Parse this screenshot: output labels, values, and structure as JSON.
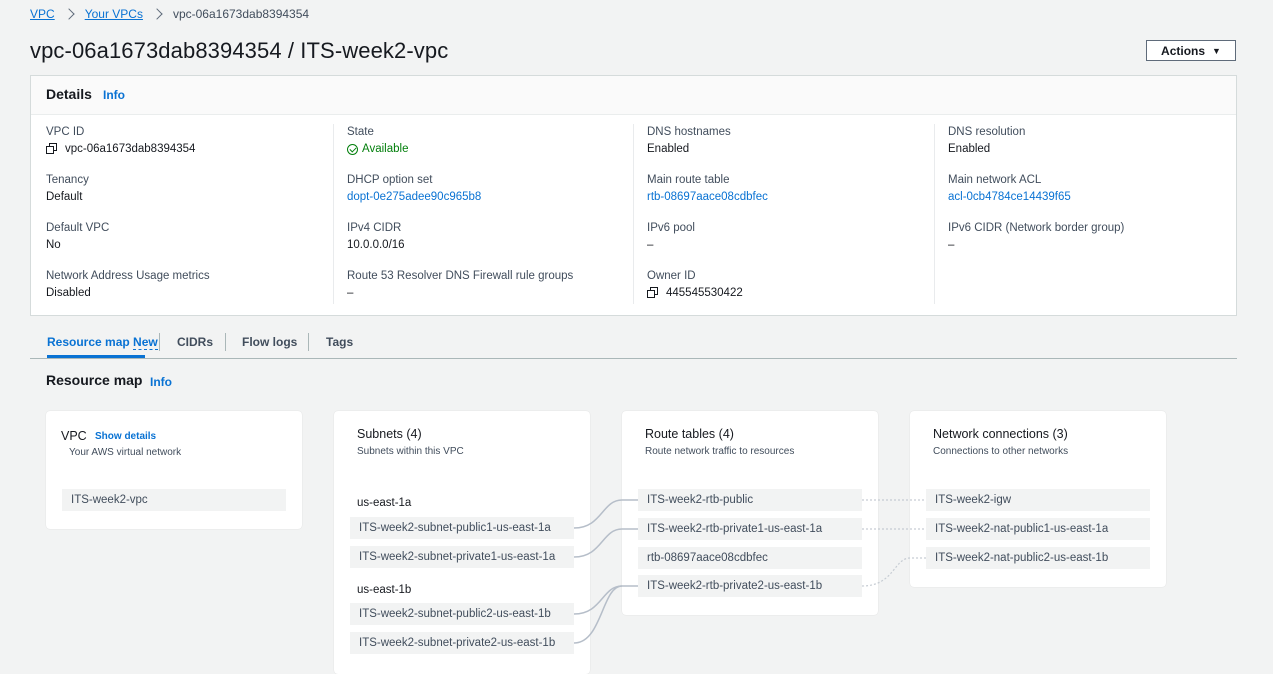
{
  "breadcrumb": {
    "vpc": "VPC",
    "your_vpcs": "Your VPCs",
    "current": "vpc-06a1673dab8394354"
  },
  "page_title": "vpc-06a1673dab8394354 / ITS-week2-vpc",
  "actions_label": "Actions",
  "details": {
    "title": "Details",
    "info": "Info",
    "fields": {
      "vpc_id": {
        "label": "VPC ID",
        "value": "vpc-06a1673dab8394354"
      },
      "state": {
        "label": "State",
        "value": "Available"
      },
      "dns_hostnames": {
        "label": "DNS hostnames",
        "value": "Enabled"
      },
      "dns_resolution": {
        "label": "DNS resolution",
        "value": "Enabled"
      },
      "tenancy": {
        "label": "Tenancy",
        "value": "Default"
      },
      "dhcp": {
        "label": "DHCP option set",
        "value": "dopt-0e275adee90c965b8"
      },
      "main_route_table": {
        "label": "Main route table",
        "value": "rtb-08697aace08cdbfec"
      },
      "main_acl": {
        "label": "Main network ACL",
        "value": "acl-0cb4784ce14439f65"
      },
      "default_vpc": {
        "label": "Default VPC",
        "value": "No"
      },
      "ipv4_cidr": {
        "label": "IPv4 CIDR",
        "value": "10.0.0.0/16"
      },
      "ipv6_pool": {
        "label": "IPv6 pool",
        "value": "–"
      },
      "ipv6_cidr": {
        "label": "IPv6 CIDR (Network border group)",
        "value": "–"
      },
      "nau_metrics": {
        "label": "Network Address Usage metrics",
        "value": "Disabled"
      },
      "route53": {
        "label": "Route 53 Resolver DNS Firewall rule groups",
        "value": "–"
      },
      "owner_id": {
        "label": "Owner ID",
        "value": "445545530422"
      }
    }
  },
  "tabs": {
    "resource_map": "Resource map",
    "new_badge": "New",
    "cidrs": "CIDRs",
    "flow_logs": "Flow logs",
    "tags": "Tags"
  },
  "resource_map": {
    "title": "Resource map",
    "info": "Info",
    "vpc": {
      "title": "VPC",
      "show_details": "Show details",
      "subtitle": "Your AWS virtual network",
      "item": "ITS-week2-vpc"
    },
    "subnets": {
      "title": "Subnets (4)",
      "subtitle": "Subnets within this VPC",
      "az1": "us-east-1a",
      "az2": "us-east-1b",
      "items": [
        "ITS-week2-subnet-public1-us-east-1a",
        "ITS-week2-subnet-private1-us-east-1a",
        "ITS-week2-subnet-public2-us-east-1b",
        "ITS-week2-subnet-private2-us-east-1b"
      ]
    },
    "route_tables": {
      "title": "Route tables (4)",
      "subtitle": "Route network traffic to resources",
      "items": [
        "ITS-week2-rtb-public",
        "ITS-week2-rtb-private1-us-east-1a",
        "rtb-08697aace08cdbfec",
        "ITS-week2-rtb-private2-us-east-1b"
      ]
    },
    "network_connections": {
      "title": "Network connections (3)",
      "subtitle": "Connections to other networks",
      "items": [
        "ITS-week2-igw",
        "ITS-week2-nat-public1-us-east-1a",
        "ITS-week2-nat-public2-us-east-1b"
      ]
    }
  }
}
